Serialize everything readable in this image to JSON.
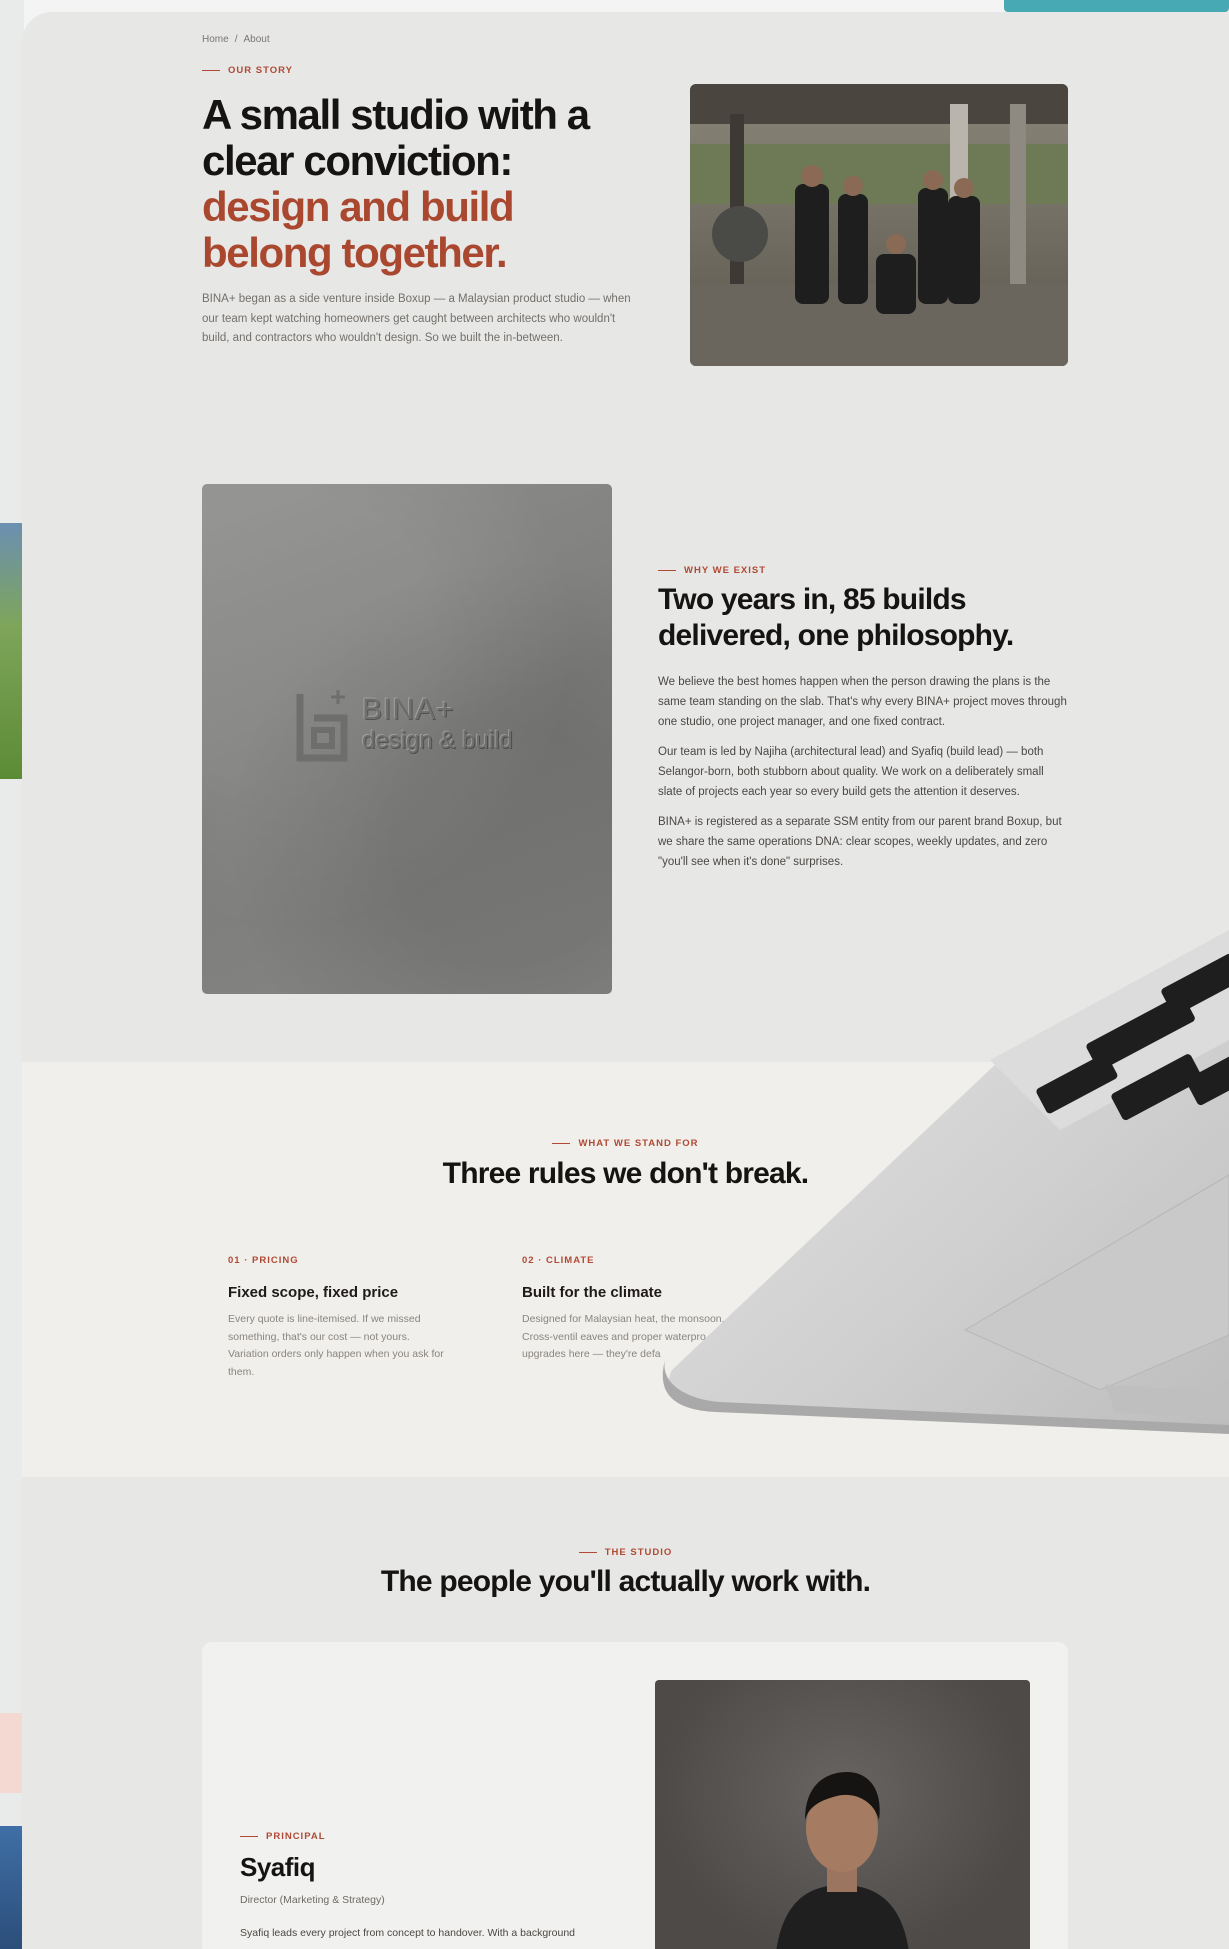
{
  "breadcrumb": {
    "home": "Home",
    "separator": "/",
    "current": "About"
  },
  "hero": {
    "eyebrow": "OUR STORY",
    "title_line1": "A small studio with a",
    "title_line2": "clear conviction:",
    "title_accent1": "design and build",
    "title_accent2": "belong together.",
    "body": "BINA+ began as a side venture inside Boxup — a Malaysian product studio — when our team kept watching homeowners get caught between architects who wouldn't build, and contractors who wouldn't design. So we built the in-between."
  },
  "brand_tile": {
    "wordmark1": "BINA+",
    "wordmark2": "design & build"
  },
  "why": {
    "eyebrow": "WHY WE EXIST",
    "title": "Two years in, 85 builds delivered, one philosophy.",
    "paragraphs": [
      "We believe the best homes happen when the person drawing the plans is the same team standing on the slab. That's why every BINA+ project moves through one studio, one project manager, and one fixed contract.",
      "Our team is led by Najiha (architectural lead) and Syafiq (build lead) — both Selangor-born, both stubborn about quality. We work on a deliberately small slate of projects each year so every build gets the attention it deserves.",
      "BINA+ is registered as a separate SSM entity from our parent brand Boxup, but we share the same operations DNA: clear scopes, weekly updates, and zero \"you'll see when it's done\" surprises."
    ]
  },
  "rules": {
    "eyebrow": "WHAT WE STAND FOR",
    "title": "Three rules we don't break.",
    "items": [
      {
        "tag": "01 · PRICING",
        "title": "Fixed scope, fixed price",
        "body": "Every quote is line-itemised. If we missed something, that's our cost — not yours. Variation orders only happen when you ask for them."
      },
      {
        "tag": "02 · CLIMATE",
        "title": "Built for the climate",
        "body": "Designed for Malaysian heat, the monsoon. Cross-ventil eaves and proper waterpro upgrades here — they're defa"
      }
    ]
  },
  "studio": {
    "eyebrow": "THE STUDIO",
    "title": "The people you'll actually work with.",
    "principal": {
      "eyebrow": "PRINCIPAL",
      "name": "Syafiq",
      "role": "Director (Marketing & Strategy)",
      "bio": "Syafiq leads every project from concept to handover. With a background"
    }
  },
  "colors": {
    "accent": "#a9472f",
    "teal": "#47a9b3",
    "page": "#e7e7e6",
    "band": "#f0efeb"
  }
}
